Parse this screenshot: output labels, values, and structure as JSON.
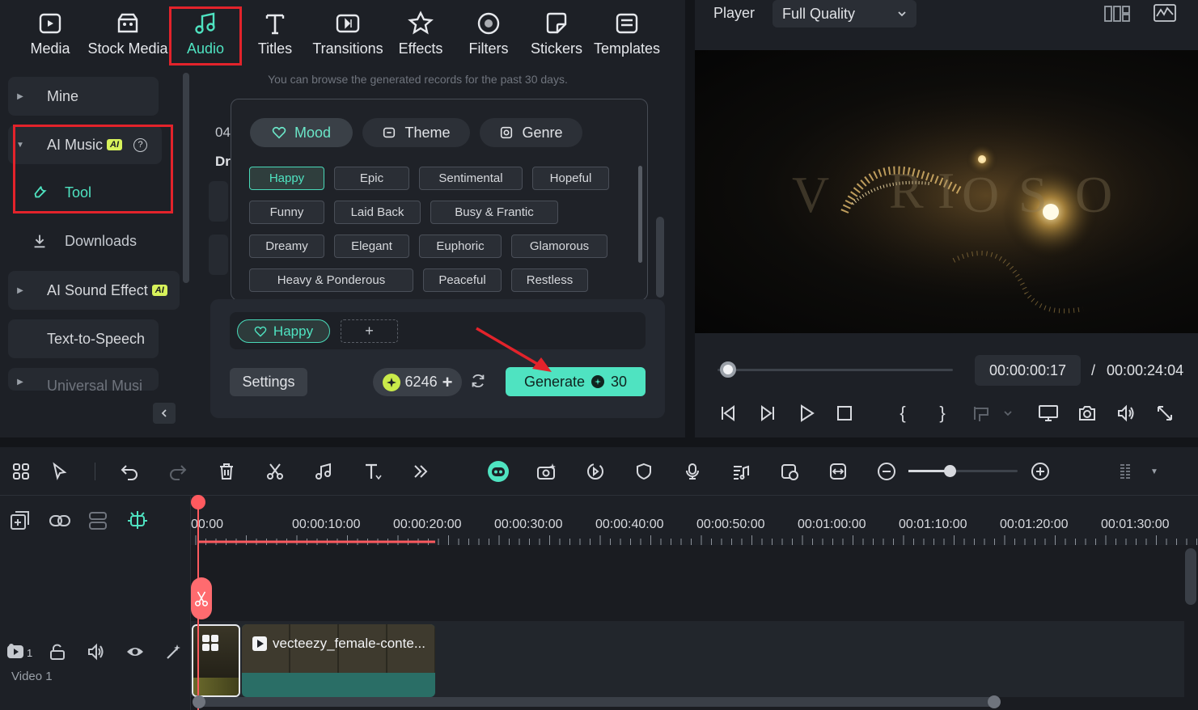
{
  "tabs": [
    {
      "label": "Media",
      "icon": "media-icon"
    },
    {
      "label": "Stock Media",
      "icon": "stock-media-icon"
    },
    {
      "label": "Audio",
      "icon": "audio-icon"
    },
    {
      "label": "Titles",
      "icon": "titles-icon"
    },
    {
      "label": "Transitions",
      "icon": "transitions-icon"
    },
    {
      "label": "Effects",
      "icon": "effects-icon"
    },
    {
      "label": "Filters",
      "icon": "filters-icon"
    },
    {
      "label": "Stickers",
      "icon": "stickers-icon"
    },
    {
      "label": "Templates",
      "icon": "templates-icon"
    }
  ],
  "active_tab": "Audio",
  "sidebar": {
    "mine": "Mine",
    "ai_music": "AI Music",
    "ai_badge": "AI",
    "tool": "Tool",
    "downloads": "Downloads",
    "ai_sound_effect": "AI Sound Effect",
    "text_to_speech": "Text-to-Speech",
    "universal_music": "Universal Musi"
  },
  "content": {
    "hint": "You can browse the generated records for the past 30 days.",
    "partial_date": "04",
    "partial_text": "Dr"
  },
  "popover": {
    "categories": [
      {
        "label": "Mood",
        "icon": "heart-icon",
        "active": true
      },
      {
        "label": "Theme",
        "icon": "theme-icon",
        "active": false
      },
      {
        "label": "Genre",
        "icon": "genre-icon",
        "active": false
      }
    ],
    "tags": {
      "happy": "Happy",
      "epic": "Epic",
      "sentimental": "Sentimental",
      "hopeful": "Hopeful",
      "funny": "Funny",
      "laid_back": "Laid Back",
      "busy_frantic": "Busy & Frantic",
      "dreamy": "Dreamy",
      "elegant": "Elegant",
      "euphoric": "Euphoric",
      "glamorous": "Glamorous",
      "heavy_ponderous": "Heavy & Ponderous",
      "peaceful": "Peaceful",
      "restless": "Restless"
    },
    "selected_tag": "Happy"
  },
  "generator": {
    "selected_chip": "Happy",
    "add_label": "+",
    "settings_label": "Settings",
    "credits": "6246",
    "credits_plus": "+",
    "generate_label": "Generate",
    "generate_cost": "30"
  },
  "player": {
    "label": "Player",
    "quality": "Full Quality",
    "current_time": "00:00:00:17",
    "separator": "/",
    "total_time": "00:00:24:04",
    "progress_fraction": 0.01
  },
  "timeline": {
    "ruler": [
      "00:00",
      "00:00:10:00",
      "00:00:20:00",
      "00:00:30:00",
      "00:00:40:00",
      "00:00:50:00",
      "00:01:00:00",
      "00:01:10:00",
      "00:01:20:00",
      "00:01:30:00"
    ],
    "clip_name": "vecteezy_female-conte...",
    "track_label": "Video 1",
    "track_number": "1"
  },
  "colors": {
    "accent": "#4fe3c1",
    "highlight_box": "#e3232b",
    "playhead": "#ff5a5f",
    "ai_badge": "#d7f25b"
  }
}
